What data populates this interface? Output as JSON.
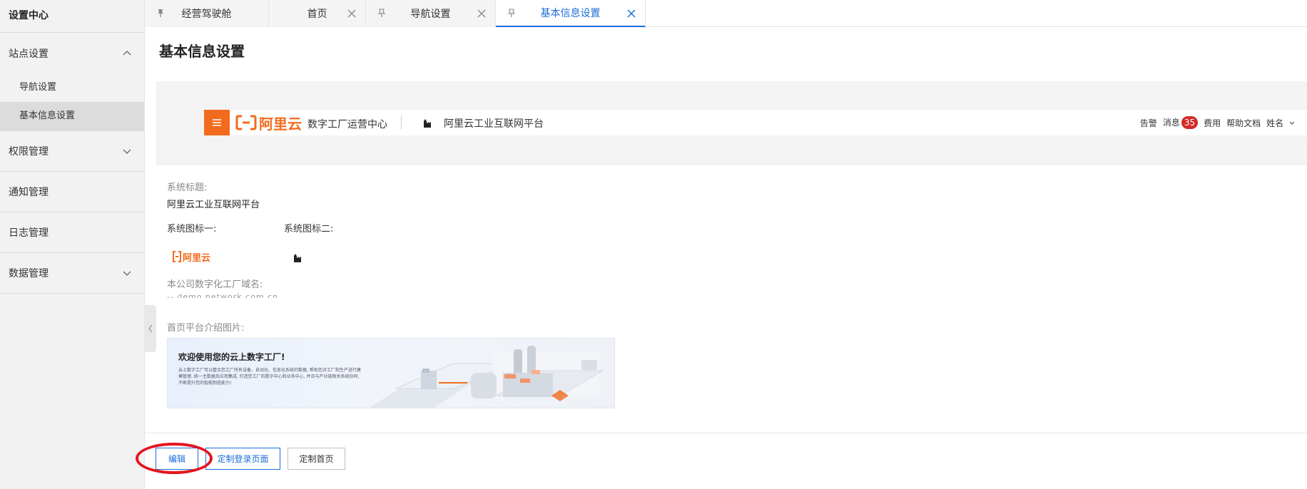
{
  "sidebar": {
    "title": "设置中心",
    "groups": [
      {
        "label": "站点设置",
        "items": [
          "导航设置",
          "基本信息设置"
        ]
      },
      {
        "label": "权限管理"
      },
      {
        "label": "通知管理"
      },
      {
        "label": "日志管理"
      },
      {
        "label": "数据管理"
      }
    ],
    "active_item": "基本信息设置"
  },
  "tabs": [
    {
      "label": "经营驾驶舱",
      "icon": "pin-icon",
      "closable": false
    },
    {
      "label": "首页",
      "closable": true
    },
    {
      "label": "导航设置",
      "icon": "pin-icon",
      "closable": true
    },
    {
      "label": "基本信息设置",
      "icon": "pin-icon",
      "closable": true,
      "active": true
    }
  ],
  "main": {
    "page_title": "基本信息设置",
    "preview_header": {
      "logo_text": "阿里云",
      "subtitle": "数字工厂运营中心",
      "platform": "阿里云工业互联网平台",
      "right_items": {
        "alarm": "告警",
        "message": "消息",
        "message_count": "35",
        "fee": "费用",
        "help": "帮助文档",
        "user": "姓名"
      }
    },
    "system_title_label": "系统标题:",
    "system_title_value": "阿里云工业互联网平台",
    "icon1_label": "系统图标一:",
    "icon2_label": "系统图标二:",
    "icon1_logo_text": "阿里云",
    "domain_label": "本公司数字化工厂域名:",
    "domain_value": "-- demo.network.com.cn",
    "intro_label": "首页平台介绍图片:",
    "banner": {
      "title": "欢迎使用您的云上数字工厂!",
      "desc": "云上数字工厂可以整合您工厂所有设备、自动化、信息化系统的数据, 帮助您对工厂和生产进行建模管理, 统一主数据及应用集成, 打造您工厂的数字中心和业务中心, 并且与产业链相关系统协同, 不断提升您的智能制造能力!"
    },
    "buttons": {
      "edit": "编辑",
      "custom_login": "定制登录页面",
      "custom_home": "定制首页"
    }
  },
  "colors": {
    "accent": "#1a6ed8",
    "brand_orange": "#f26b1d",
    "annotation": "#e5141e",
    "badge": "#d32a2a"
  }
}
